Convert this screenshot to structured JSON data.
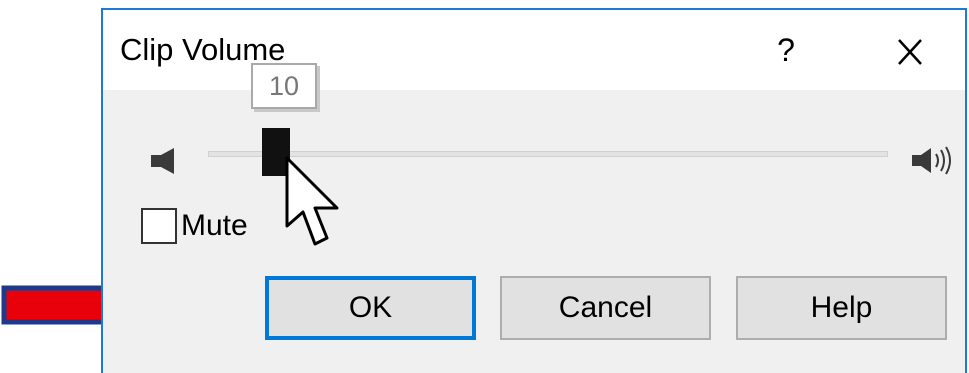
{
  "window": {
    "title": "Clip Volume",
    "help_symbol": "?",
    "close_symbol": "✕",
    "accent_color": "#1e7ad6"
  },
  "slider": {
    "value": 10,
    "value_label": "10",
    "min": 0,
    "max": 100,
    "left_icon": "speaker-low-icon",
    "right_icon": "speaker-high-icon"
  },
  "mute": {
    "label": "Mute",
    "checked": false
  },
  "buttons": {
    "ok": "OK",
    "cancel": "Cancel",
    "help": "Help"
  },
  "annotation": {
    "arrow_color": "#e8000b",
    "arrow_outline": "#1f3a8a"
  }
}
